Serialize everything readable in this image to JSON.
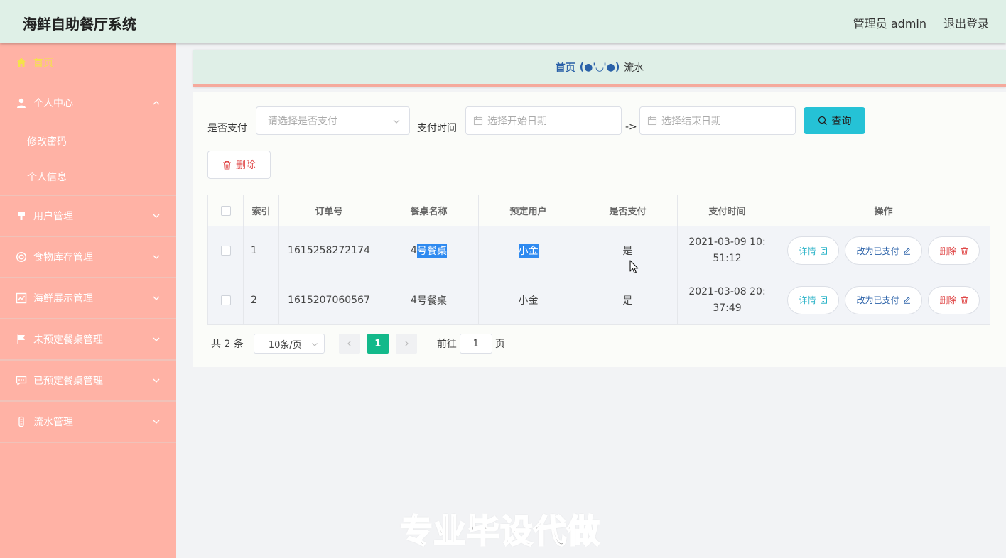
{
  "header": {
    "title": "海鲜自助餐厅系统",
    "user": "管理员 admin",
    "logout": "退出登录"
  },
  "sidebar": {
    "home": "首页",
    "items": [
      {
        "label": "个人中心",
        "icon": "user-icon",
        "sub": [
          "修改密码",
          "个人信息"
        ]
      },
      {
        "label": "用户管理",
        "icon": "stamp-icon"
      },
      {
        "label": "食物库存管理",
        "icon": "lifebuoy-icon"
      },
      {
        "label": "海鲜展示管理",
        "icon": "chart-icon"
      },
      {
        "label": "未预定餐桌管理",
        "icon": "flag-icon"
      },
      {
        "label": "已预定餐桌管理",
        "icon": "chat-icon"
      },
      {
        "label": "流水管理",
        "icon": "tube-icon"
      }
    ]
  },
  "breadcrumb": {
    "home": "首页",
    "sep": "(●'◡'●)",
    "current": "流水"
  },
  "filters": {
    "paid_label": "是否支付",
    "paid_placeholder": "请选择是否支付",
    "time_label": "支付时间",
    "start_placeholder": "选择开始日期",
    "to": "->",
    "end_placeholder": "选择结束日期",
    "query": "查询"
  },
  "actions": {
    "delete": "删除"
  },
  "table": {
    "headers": [
      "索引",
      "订单号",
      "餐桌名称",
      "预定用户",
      "是否支付",
      "支付时间",
      "操作"
    ],
    "rows": [
      {
        "index": "1",
        "order": "1615258272174",
        "table_pre": "4",
        "table_hl": "号餐桌",
        "user": "小金",
        "paid": "是",
        "time": "2021-03-09 10:51:12"
      },
      {
        "index": "2",
        "order": "1615207060567",
        "table_pre": "4",
        "table_hl": "号餐桌",
        "user": "小金",
        "paid": "是",
        "time": "2021-03-08 20:37:49"
      }
    ],
    "ops": {
      "detail": "详情",
      "paid": "改为已支付",
      "delete": "删除"
    }
  },
  "pager": {
    "total": "共 2 条",
    "size": "10条/页",
    "page": "1",
    "goto": "前往",
    "jump": "1",
    "unit": "页"
  },
  "watermark": "专业毕设代做"
}
